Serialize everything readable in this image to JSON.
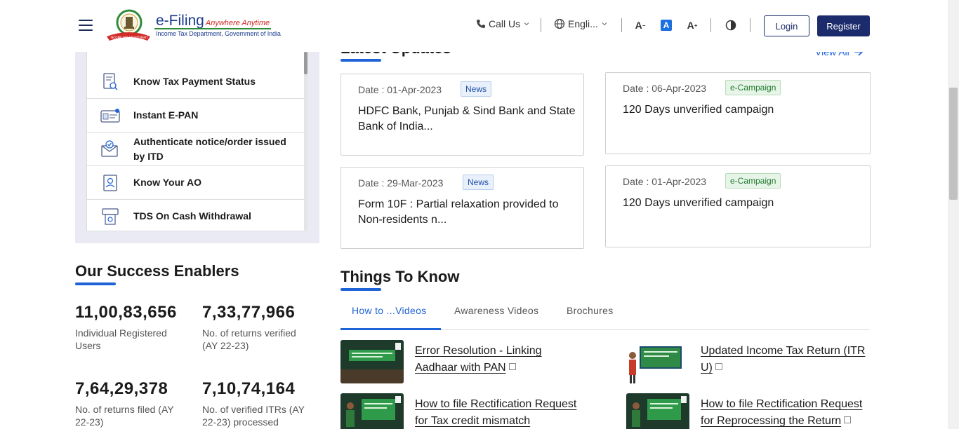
{
  "header": {
    "logo_title": "e-Filing",
    "logo_tagline": "Anywhere Anytime",
    "logo_subtitle": "Income Tax Department, Government of India",
    "call_us": "Call Us",
    "language": "Engli...",
    "font_decrease": "A",
    "font_normal": "A",
    "font_increase": "A",
    "login": "Login",
    "register": "Register"
  },
  "quick_links": {
    "items": [
      {
        "label": "Know Tax Payment Status",
        "icon": "receipt-search-icon"
      },
      {
        "label": "Instant E-PAN",
        "icon": "pan-card-icon"
      },
      {
        "label": "Authenticate notice/order issued by ITD",
        "icon": "envelope-check-icon"
      },
      {
        "label": "Know Your AO",
        "icon": "officer-document-icon"
      },
      {
        "label": "TDS On Cash Withdrawal",
        "icon": "atm-cash-icon"
      }
    ]
  },
  "success_enablers": {
    "title": "Our Success Enablers",
    "stats": [
      {
        "value": "11,00,83,656",
        "label": "Individual Registered Users"
      },
      {
        "value": "7,33,77,966",
        "label": "No. of returns verified (AY 22-23)"
      },
      {
        "value": "7,64,29,378",
        "label": "No. of returns filed (AY 22-23)"
      },
      {
        "value": "7,10,74,164",
        "label": "No. of verified ITRs (AY 22-23) processed"
      }
    ]
  },
  "latest_updates": {
    "title": "Latest Updates",
    "view_all": "View All",
    "cards": [
      {
        "date": "Date : 01-Apr-2023",
        "badge": "News",
        "text": "HDFC Bank, Punjab & Sind Bank and State Bank of India..."
      },
      {
        "date": "Date : 06-Apr-2023",
        "badge": "e-Campaign",
        "text": "120 Days unverified campaign"
      },
      {
        "date": "Date : 29-Mar-2023",
        "badge": "News",
        "text": "Form 10F : Partial relaxation provided to Non-residents n..."
      },
      {
        "date": "Date : 01-Apr-2023",
        "badge": "e-Campaign",
        "text": "120 Days unverified campaign"
      }
    ]
  },
  "things_to_know": {
    "title": "Things To Know",
    "tabs": [
      "How to ...Videos",
      "Awareness Videos",
      "Brochures"
    ],
    "videos": [
      {
        "title": "Error Resolution - Linking Aadhaar with PAN"
      },
      {
        "title": "Updated Income Tax Return (ITR U)"
      },
      {
        "title": "How to file Rectification Request for Tax credit mismatch"
      },
      {
        "title": "How to file Rectification Request for Reprocessing the Return"
      }
    ]
  },
  "colors": {
    "primary": "#1c2b6b",
    "accent": "#1e63d8",
    "news_badge": "#e8f0fb",
    "campaign_badge": "#e7f5e8"
  }
}
